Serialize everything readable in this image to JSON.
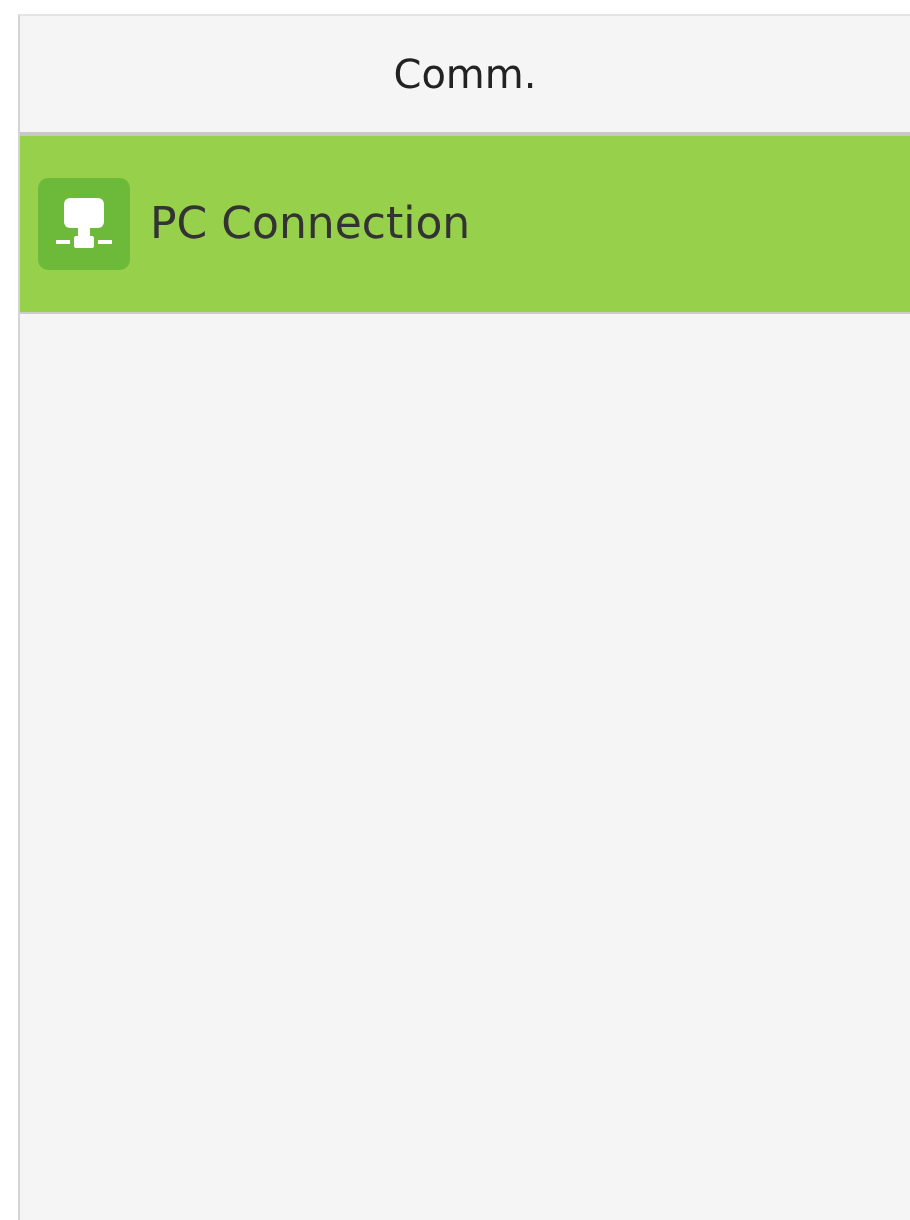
{
  "title": "Comm.",
  "items": [
    {
      "label": "PC Connection",
      "selected": true
    }
  ]
}
